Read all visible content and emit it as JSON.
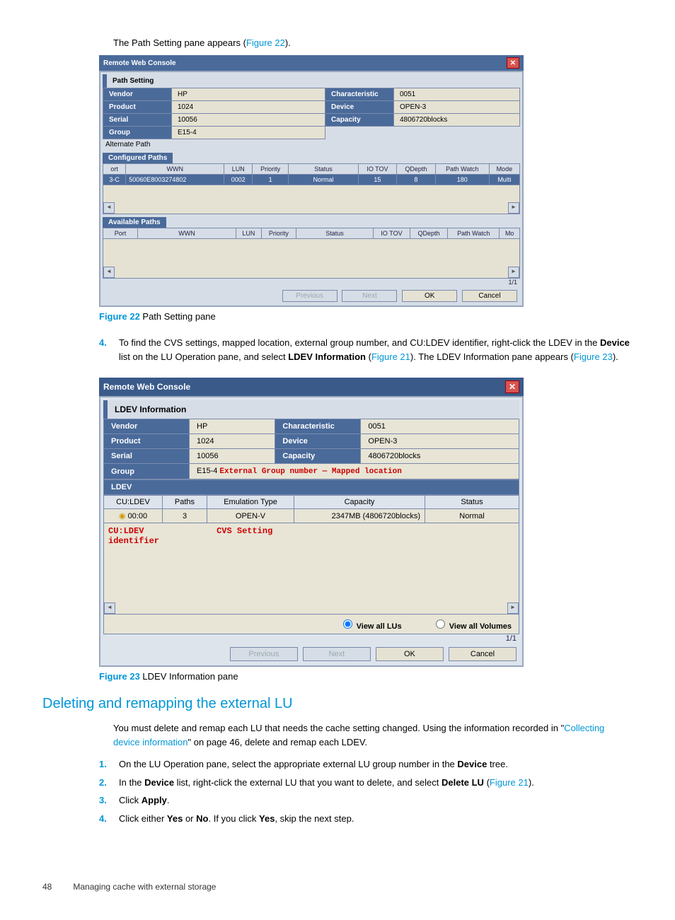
{
  "intro": {
    "text_before_link": "The Path Setting pane appears (",
    "link": "Figure 22",
    "text_after_link": ")."
  },
  "fig22": {
    "window_title": "Remote Web Console",
    "pane_title": "Path Setting",
    "rows": {
      "vendor_lbl": "Vendor",
      "vendor": "HP",
      "characteristic_lbl": "Characteristic",
      "characteristic": "0051",
      "product_lbl": "Product",
      "product": "1024",
      "device_lbl": "Device",
      "device": "OPEN-3",
      "serial_lbl": "Serial",
      "serial": "10056",
      "capacity_lbl": "Capacity",
      "capacity": "4806720blocks",
      "group_lbl": "Group",
      "group": "E15-4"
    },
    "alt_path_label": "Alternate Path",
    "configured_label": "Configured Paths",
    "grid_headers": [
      "ort",
      "WWN",
      "LUN",
      "Priority",
      "Status",
      "IO TOV",
      "QDepth",
      "Path Watch",
      "Mode"
    ],
    "grid_row": [
      "3-C",
      "50060E8003274802",
      "0002",
      "1",
      "Normal",
      "15",
      "8",
      "180",
      "Multi"
    ],
    "available_label": "Available Paths",
    "grid2_headers": [
      "Port",
      "WWN",
      "LUN",
      "Priority",
      "Status",
      "IO TOV",
      "QDepth",
      "Path Watch",
      "Mo"
    ],
    "page_ind": "1/1",
    "btn_prev": "Previous",
    "btn_next": "Next",
    "btn_ok": "OK",
    "btn_cancel": "Cancel",
    "caption_label": "Figure 22",
    "caption_text": " Path Setting pane"
  },
  "step4": {
    "num": "4.",
    "l1a": "To find the CVS settings, mapped location, external group number, and CU:LDEV identifier, right-click ",
    "l1b": "the LDEV in the ",
    "bold1": "Device",
    "l1c": " list on the LU Operation pane, and select ",
    "bold2": "LDEV Information",
    "l1d": " (",
    "link1": "Figure 21",
    "l1e": "). The ",
    "l2a": "LDEV Information pane appears (",
    "link2": "Figure 23",
    "l2b": ")."
  },
  "fig23": {
    "window_title": "Remote Web Console",
    "pane_title": "LDEV Information",
    "rows": {
      "vendor_lbl": "Vendor",
      "vendor": "HP",
      "characteristic_lbl": "Characteristic",
      "characteristic": "0051",
      "product_lbl": "Product",
      "product": "1024",
      "device_lbl": "Device",
      "device": "OPEN-3",
      "serial_lbl": "Serial",
      "serial": "10056",
      "capacity_lbl": "Capacity",
      "capacity": "4806720blocks",
      "group_lbl": "Group",
      "group_val": "E15-4",
      "group_ann": "External Group number — Mapped location",
      "ldev_lbl": "LDEV"
    },
    "grid_headers": [
      "CU:LDEV",
      "Paths",
      "Emulation Type",
      "Capacity",
      "Status"
    ],
    "grid_row": [
      "00:00",
      "3",
      "OPEN-V",
      "2347MB (4806720blocks)",
      "Normal"
    ],
    "ann1": "CU:LDEV identifier",
    "ann2": "CVS Setting",
    "radio1": "View all LUs",
    "radio2": "View all Volumes",
    "page_ind": "1/1",
    "btn_prev": "Previous",
    "btn_next": "Next",
    "btn_ok": "OK",
    "btn_cancel": "Cancel",
    "caption_label": "Figure 23",
    "caption_text": " LDEV Information pane"
  },
  "section_heading": "Deleting and remapping the external LU",
  "para": {
    "a": "You must delete and remap each LU that needs the cache setting changed. Using the information recorded in \"",
    "link": "Collecting device information",
    "b": "\" on page 46, delete and remap each LDEV."
  },
  "steps2": {
    "s1_num": "1.",
    "s1a": "On the LU Operation pane, select the appropriate external LU group number in the ",
    "s1b": "Device",
    "s1c": " tree.",
    "s2_num": "2.",
    "s2a": "In the ",
    "s2b": "Device",
    "s2c": " list, right-click the external LU that you want to delete, and select ",
    "s2d": "Delete LU",
    "s2e": " (",
    "s2link": "Figure 21",
    "s2f": ").",
    "s3_num": "3.",
    "s3a": "Click ",
    "s3b": "Apply",
    "s3c": ".",
    "s4_num": "4.",
    "s4a": "Click either ",
    "s4b": "Yes",
    "s4c": " or ",
    "s4d": "No",
    "s4e": ". If you click ",
    "s4f": "Yes",
    "s4g": ", skip the next step."
  },
  "footer": {
    "page": "48",
    "title": "Managing cache with external storage"
  }
}
